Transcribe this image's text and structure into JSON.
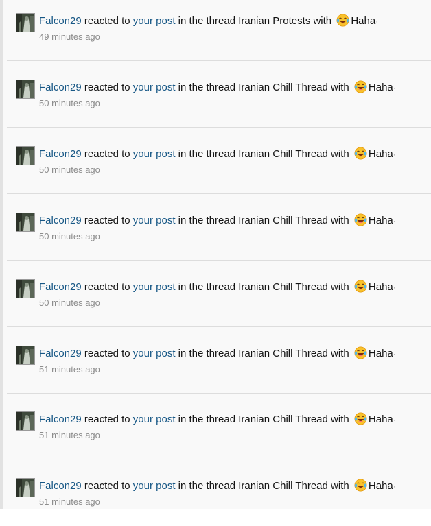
{
  "alerts": [
    {
      "user": "Falcon29",
      "reacted_text": "reacted to",
      "post_link": "your post",
      "thread_text": "in the thread",
      "thread": "Iranian Protests",
      "with_text": "with",
      "reaction": "Haha",
      "time": "49 minutes ago"
    },
    {
      "user": "Falcon29",
      "reacted_text": "reacted to",
      "post_link": "your post",
      "thread_text": "in the thread",
      "thread": "Iranian Chill Thread",
      "with_text": "with",
      "reaction": "Haha",
      "time": "50 minutes ago"
    },
    {
      "user": "Falcon29",
      "reacted_text": "reacted to",
      "post_link": "your post",
      "thread_text": "in the thread",
      "thread": "Iranian Chill Thread",
      "with_text": "with",
      "reaction": "Haha",
      "time": "50 minutes ago"
    },
    {
      "user": "Falcon29",
      "reacted_text": "reacted to",
      "post_link": "your post",
      "thread_text": "in the thread",
      "thread": "Iranian Chill Thread",
      "with_text": "with",
      "reaction": "Haha",
      "time": "50 minutes ago"
    },
    {
      "user": "Falcon29",
      "reacted_text": "reacted to",
      "post_link": "your post",
      "thread_text": "in the thread",
      "thread": "Iranian Chill Thread",
      "with_text": "with",
      "reaction": "Haha",
      "time": "50 minutes ago"
    },
    {
      "user": "Falcon29",
      "reacted_text": "reacted to",
      "post_link": "your post",
      "thread_text": "in the thread",
      "thread": "Iranian Chill Thread",
      "with_text": "with",
      "reaction": "Haha",
      "time": "51 minutes ago"
    },
    {
      "user": "Falcon29",
      "reacted_text": "reacted to",
      "post_link": "your post",
      "thread_text": "in the thread",
      "thread": "Iranian Chill Thread",
      "with_text": "with",
      "reaction": "Haha",
      "time": "51 minutes ago"
    },
    {
      "user": "Falcon29",
      "reacted_text": "reacted to",
      "post_link": "your post",
      "thread_text": "in the thread",
      "thread": "Iranian Chill Thread",
      "with_text": "with",
      "reaction": "Haha",
      "time": "51 minutes ago"
    }
  ],
  "icons": {
    "avatar": "user-avatar-image",
    "reaction": "laughing-tears-emoji-icon"
  },
  "colors": {
    "link": "#185886",
    "text": "#141414",
    "meta": "#8c8c8c",
    "background": "#f9f9f9",
    "divider": "#dddddd"
  }
}
